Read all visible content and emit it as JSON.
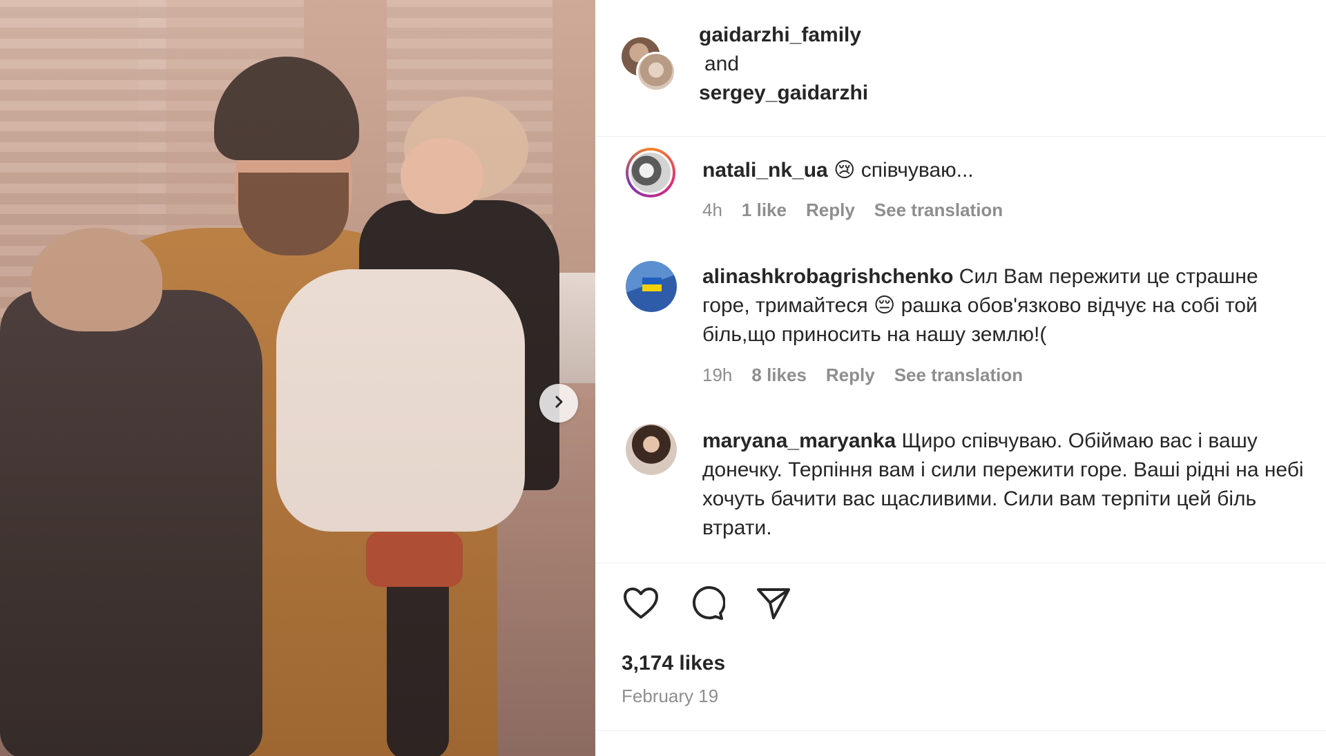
{
  "header": {
    "author_1": "gaidarzhi_family",
    "and": "and",
    "author_2": "sergey_gaidarzhi"
  },
  "comments": [
    {
      "username": "natali_nk_ua",
      "emoji": "😢",
      "text": "співчуваю...",
      "time": "4h",
      "likes": "1 like",
      "reply": "Reply",
      "translate": "See translation"
    },
    {
      "username": "alinashkrobagrishchenko",
      "text_before": "Сил Вам пережити це страшне горе, тримайтеся",
      "emoji": "😔",
      "text_after": "рашка обов'язково відчує на собі той біль,що приносить на нашу землю!(",
      "time": "19h",
      "likes": "8 likes",
      "reply": "Reply",
      "translate": "See translation"
    },
    {
      "username": "maryana_maryanka",
      "text": "Щиро співчуваю. Обіймаю вас і вашу донечку. Терпіння вам і сили пережити горе. Ваші рідні на небі хочуть бачити вас щасливими. Сили вам терпіти цей біль втрати."
    }
  ],
  "post": {
    "likes": "3,174 likes",
    "date": "February 19"
  },
  "icons": {
    "like": "heart-icon",
    "comment": "comment-bubble-icon",
    "share": "paper-plane-icon",
    "next": "chevron-right-icon"
  },
  "colors": {
    "text": "#262626",
    "muted": "#8e8e8e",
    "divider": "#efefef"
  }
}
